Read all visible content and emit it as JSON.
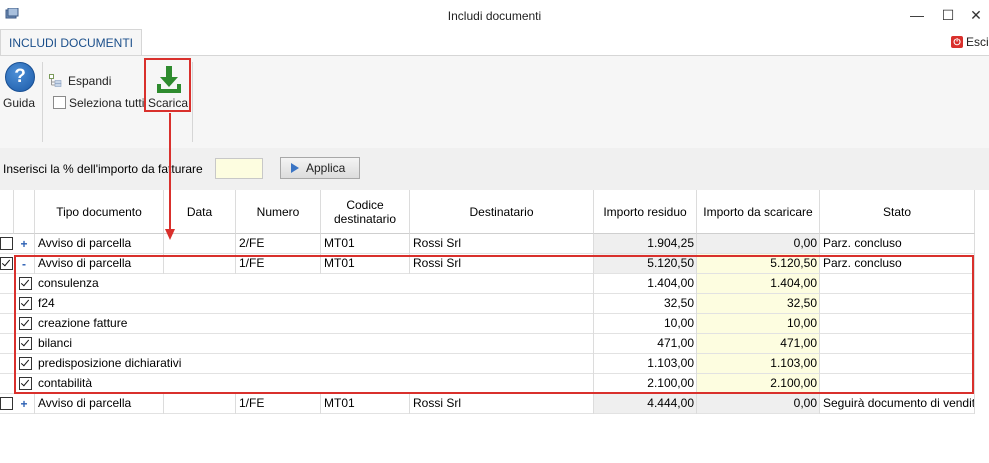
{
  "window": {
    "title": "Includi documenti",
    "controls": [
      "minimize-icon",
      "maximize-icon",
      "close-icon"
    ],
    "minimize_glyph": "—",
    "maximize_glyph": "☐",
    "close_glyph": "✕"
  },
  "ribbon": {
    "tab_label": "INCLUDI DOCUMENTI",
    "exit_label": "Esci",
    "guida_label": "Guida",
    "guida_glyph": "?",
    "espandi_label": "Espandi",
    "seleziona_label": "Seleziona tutti",
    "scarica_label": "Scarica"
  },
  "percent_bar": {
    "label": "Inserisci la % dell'importo da fatturare",
    "input_value": "",
    "applica_label": "Applica"
  },
  "grid": {
    "headers": [
      "Tipo documento",
      "Data",
      "Numero",
      "Codice destinatario",
      "Destinatario",
      "Importo residuo",
      "Importo da scaricare",
      "Stato"
    ],
    "rows": [
      {
        "kind": "doc",
        "checked": false,
        "expander": "+",
        "tipo": "Avviso di parcella",
        "data": "",
        "numero": "2/FE",
        "codice": "MT01",
        "destinatario": "Rossi Srl",
        "residuo": "1.904,25",
        "scaricare": "0,00",
        "stato": "Parz. concluso"
      },
      {
        "kind": "doc",
        "checked": true,
        "expander": "-",
        "tipo": "Avviso di parcella",
        "data": "",
        "numero": "1/FE",
        "codice": "MT01",
        "destinatario": "Rossi Srl",
        "residuo": "5.120,50",
        "scaricare": "5.120,50",
        "stato": "Parz. concluso"
      },
      {
        "kind": "sub",
        "checked": true,
        "tipo": "consulenza",
        "residuo": "1.404,00",
        "scaricare": "1.404,00"
      },
      {
        "kind": "sub",
        "checked": true,
        "tipo": "f24",
        "residuo": "32,50",
        "scaricare": "32,50"
      },
      {
        "kind": "sub",
        "checked": true,
        "tipo": "creazione fatture",
        "residuo": "10,00",
        "scaricare": "10,00"
      },
      {
        "kind": "sub",
        "checked": true,
        "tipo": "bilanci",
        "residuo": "471,00",
        "scaricare": "471,00"
      },
      {
        "kind": "sub",
        "checked": true,
        "tipo": "predisposizione dichiarativi",
        "residuo": "1.103,00",
        "scaricare": "1.103,00"
      },
      {
        "kind": "sub",
        "checked": true,
        "tipo": "contabilità",
        "residuo": "2.100,00",
        "scaricare": "2.100,00"
      },
      {
        "kind": "doc",
        "checked": false,
        "expander": "+",
        "tipo": "Avviso di parcella",
        "data": "",
        "numero": "1/FE",
        "codice": "MT01",
        "destinatario": "Rossi Srl",
        "residuo": "4.444,00",
        "scaricare": "0,00",
        "stato": "Seguirà documento di vendita"
      }
    ]
  },
  "colors": {
    "accent_red": "#d9302c",
    "tab_blue": "#1a4e8a",
    "input_yellow": "#fdfde0",
    "download_green": "#2e8b2e"
  }
}
